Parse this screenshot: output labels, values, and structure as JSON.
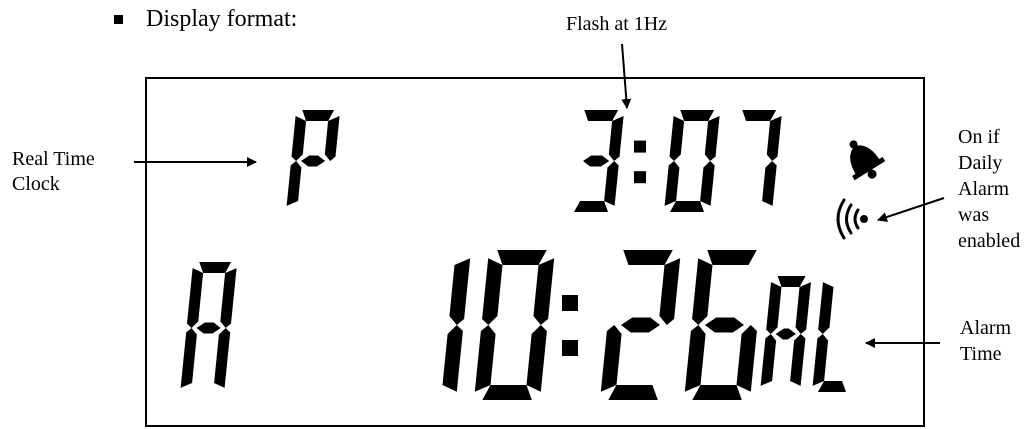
{
  "heading": "Display format:",
  "labels": {
    "flash": "Flash at 1Hz",
    "rtc_line1": "Real Time",
    "rtc_line2": "Clock",
    "alarm_on_line1": "On if",
    "alarm_on_line2": "Daily",
    "alarm_on_line3": "Alarm",
    "alarm_on_line4": "was",
    "alarm_on_line5": "enabled",
    "alarm_time_line1": "Alarm",
    "alarm_time_line2": "Time"
  },
  "lcd": {
    "rtc_period": "P",
    "rtc_time": "3:07",
    "alarm_period": "A",
    "alarm_time": "10:26",
    "alarm_tag": "AL"
  },
  "icons": [
    "bell-icon",
    "alarm-waves-icon"
  ],
  "colors": {
    "ink": "#000000",
    "background": "#ffffff"
  }
}
